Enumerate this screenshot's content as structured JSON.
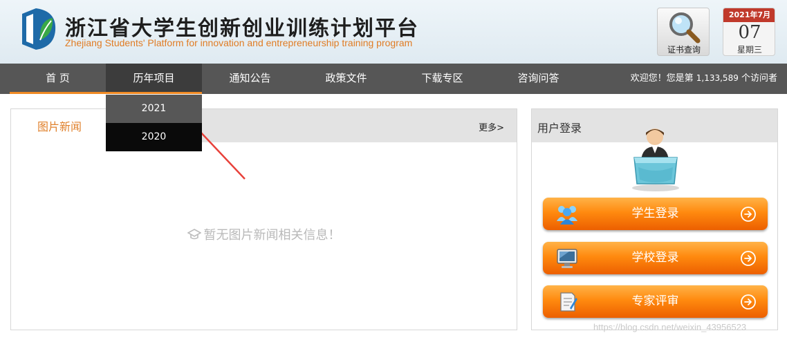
{
  "header": {
    "site_title": "浙江省大学生创新创业训练计划平台",
    "site_subtitle": "Zhejiang Students' Platform for innovation and entrepreneurship training program",
    "cert_query_label": "证书查询",
    "calendar": {
      "month": "2021年7月",
      "day": "07",
      "weekday": "星期三"
    }
  },
  "nav": {
    "items": [
      {
        "label": "首 页"
      },
      {
        "label": "历年项目"
      },
      {
        "label": "通知公告"
      },
      {
        "label": "政策文件"
      },
      {
        "label": "下载专区"
      },
      {
        "label": "咨询问答"
      }
    ],
    "visitor_prefix": "欢迎您！您是第",
    "visitor_count": "1,133,589",
    "visitor_suffix": "个访问者",
    "dropdown": [
      "2021",
      "2020"
    ]
  },
  "news": {
    "tab_label": "图片新闻",
    "more_label": "更多>",
    "empty_message": "暂无图片新闻相关信息！"
  },
  "login": {
    "title": "用户登录",
    "buttons": [
      {
        "label": "学生登录",
        "icon": "students-icon"
      },
      {
        "label": "学校登录",
        "icon": "monitor-icon"
      },
      {
        "label": "专家评审",
        "icon": "document-icon"
      }
    ]
  },
  "watermark": "https://blog.csdn.net/weixin_43956523",
  "colors": {
    "accent_orange": "#f08a24",
    "nav_bg": "#565656",
    "button_orange": "#ff8a0f",
    "calendar_red": "#c0392b"
  }
}
